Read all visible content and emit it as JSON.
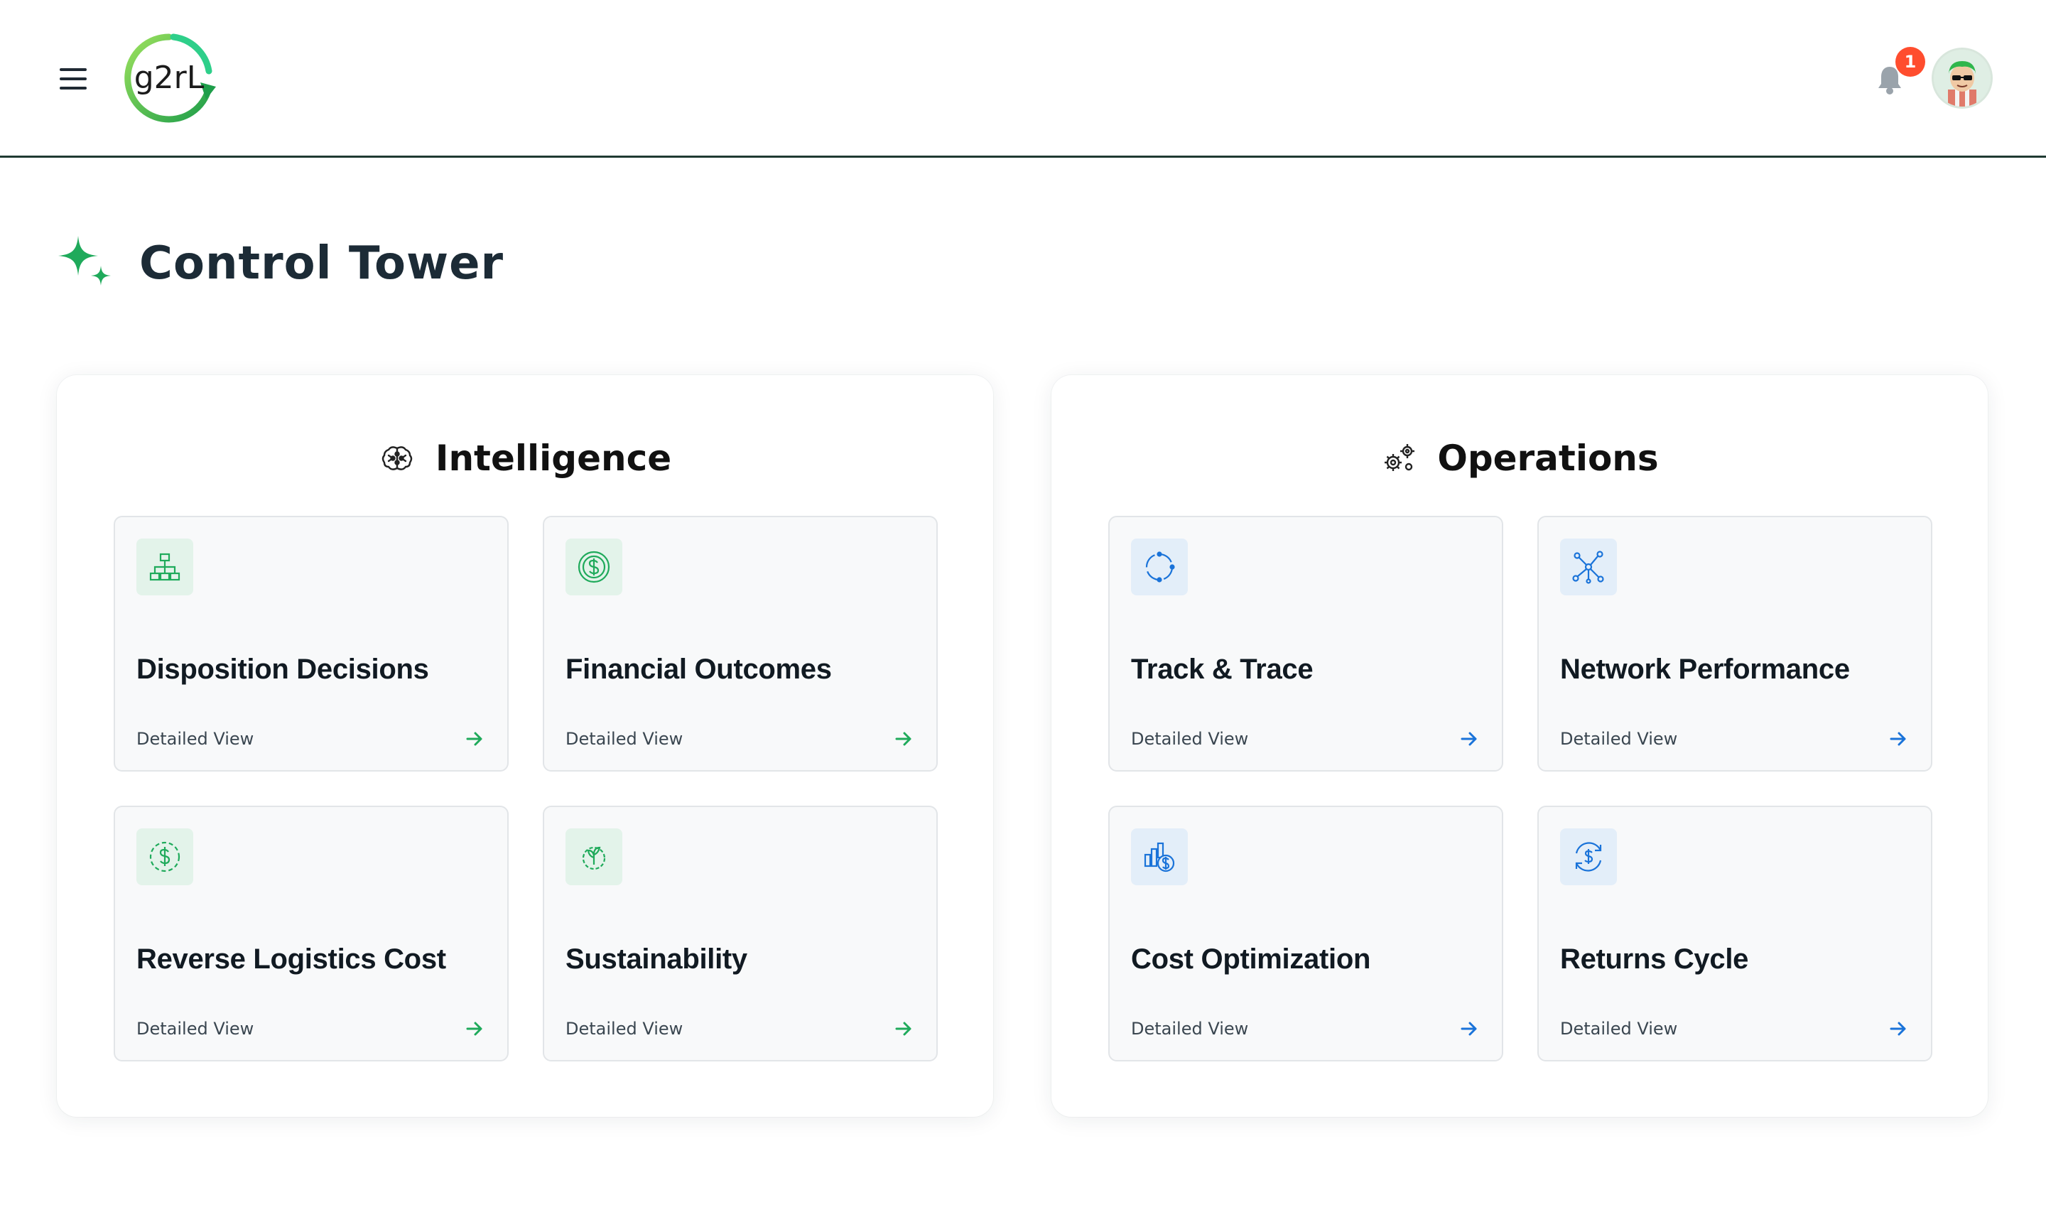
{
  "header": {
    "logo_text": "g2rL",
    "notification_count": "1"
  },
  "page": {
    "title": "Control Tower"
  },
  "colors": {
    "green_accent": "#1faa5b",
    "blue_accent": "#1a73d9",
    "badge": "#ff4d2e",
    "header_border": "#1f3a32"
  },
  "panels": [
    {
      "title": "Intelligence",
      "icon": "brain-icon",
      "cards": [
        {
          "title": "Disposition Decisions",
          "link": "Detailed View",
          "icon": "hierarchy-icon"
        },
        {
          "title": "Financial Outcomes",
          "link": "Detailed View",
          "icon": "dollar-coin-icon"
        },
        {
          "title": "Reverse Logistics Cost",
          "link": "Detailed View",
          "icon": "dollar-cycle-icon"
        },
        {
          "title": "Sustainability",
          "link": "Detailed View",
          "icon": "leaf-gear-icon"
        }
      ]
    },
    {
      "title": "Operations",
      "icon": "gears-icon",
      "cards": [
        {
          "title": "Track & Trace",
          "link": "Detailed View",
          "icon": "circle-track-icon"
        },
        {
          "title": "Network Performance",
          "link": "Detailed View",
          "icon": "network-icon"
        },
        {
          "title": "Cost Optimization",
          "link": "Detailed View",
          "icon": "cost-chart-icon"
        },
        {
          "title": "Returns Cycle",
          "link": "Detailed View",
          "icon": "return-dollar-icon"
        }
      ]
    }
  ]
}
